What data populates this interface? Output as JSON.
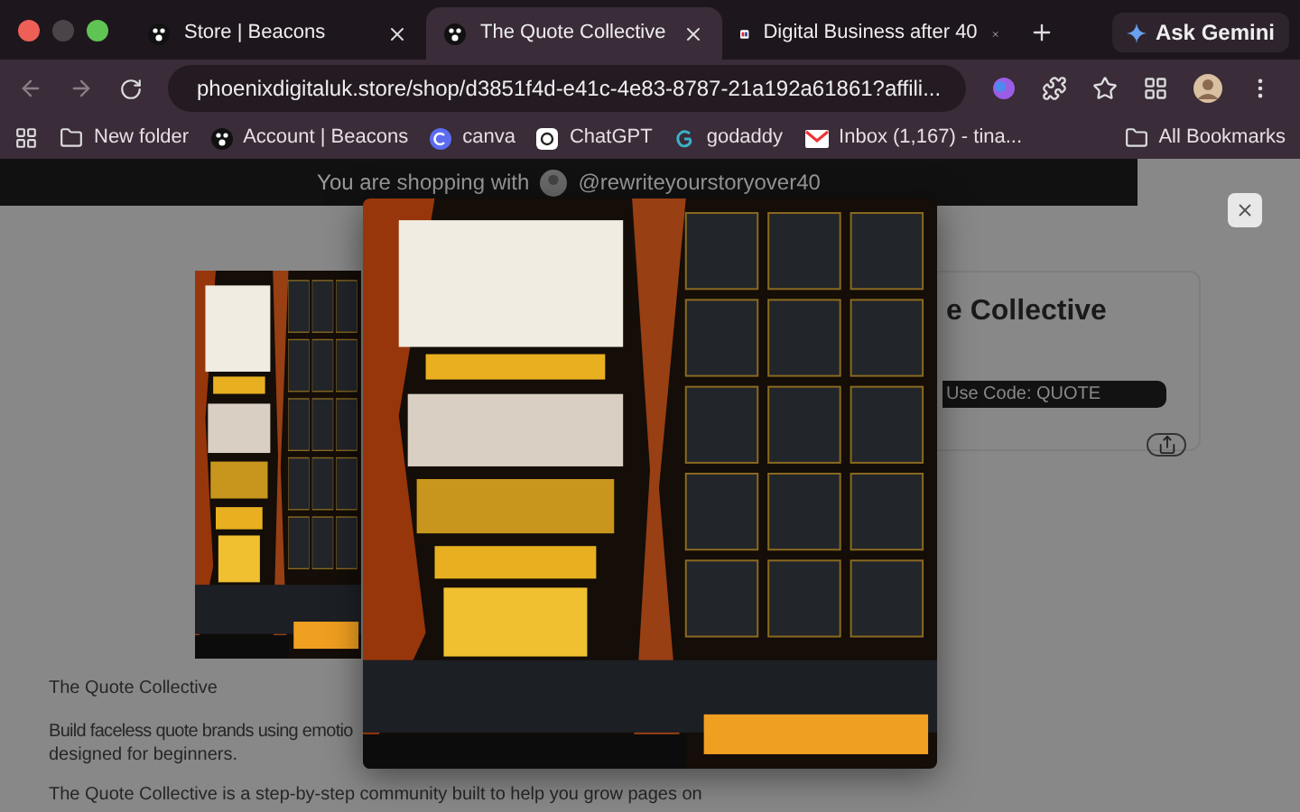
{
  "browser": {
    "tabs": [
      {
        "title": "Store | Beacons",
        "selected": false
      },
      {
        "title": "The Quote Collective",
        "selected": true
      },
      {
        "title": "Digital Business after 40",
        "selected": false
      }
    ],
    "ask_gemini": "Ask Gemini",
    "url": "phoenixdigitaluk.store/shop/d3851f4d-e41c-4e83-8787-21a192a61861?affili...",
    "bookmarks": [
      {
        "label": "New folder"
      },
      {
        "label": "Account | Beacons"
      },
      {
        "label": "canva"
      },
      {
        "label": "ChatGPT"
      },
      {
        "label": "godaddy"
      },
      {
        "label": "Inbox (1,167) - tina..."
      }
    ],
    "all_bookmarks": "All Bookmarks"
  },
  "banner": {
    "prefix": "You are shopping with",
    "handle": "@rewriteyourstoryover40"
  },
  "product": {
    "title": "e Collective",
    "promo_button": "Use Code: QUOTE",
    "name": "The Quote Collective",
    "lines": [
      "Build faceless quote brands using emotio",
      "designed for beginners."
    ],
    "paragraph": "The Quote Collective is a step-by-step community built to help you grow pages on"
  }
}
